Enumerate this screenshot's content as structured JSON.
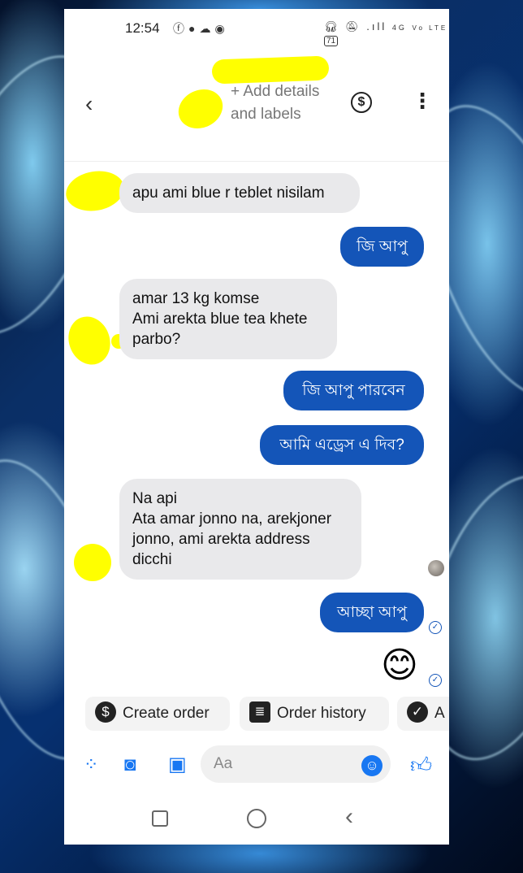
{
  "status_bar": {
    "time": "12:54",
    "left_icons": [
      "facebook-icon",
      "messenger-icon",
      "cloud-icon",
      "app-icon"
    ],
    "right_icons": [
      "headphones-icon",
      "mute-icon",
      "signal-icon",
      "4g-icon",
      "volte-icon"
    ],
    "signal_label": ".ıll",
    "network": "4G",
    "volte": "Vo LTE",
    "battery": "71"
  },
  "header": {
    "back_icon": "chevron-left-icon",
    "add_details_label": "+ Add details and labels",
    "payment_icon": "dollar-circle-icon",
    "more_icon": "more-vertical-icon"
  },
  "messages": [
    {
      "side": "in",
      "text": "apu ami blue r teblet nisilam"
    },
    {
      "side": "out",
      "text": "জি আপু"
    },
    {
      "side": "in",
      "text": "amar 13 kg komse\nAmi arekta blue tea khete parbo?"
    },
    {
      "side": "out",
      "text": "জি আপু পারবেন"
    },
    {
      "side": "out",
      "text": "আমি এড্রেস এ দিব?"
    },
    {
      "side": "in",
      "text": "Na api\nAta amar jonno na, arekjoner jonno, ami arekta address dicchi"
    },
    {
      "side": "out",
      "text": "আচ্ছা আপু"
    },
    {
      "side": "out",
      "text": "😊"
    }
  ],
  "quick_actions": [
    {
      "label": "Create order",
      "icon": "dollar-icon"
    },
    {
      "label": "Order history",
      "icon": "receipt-icon"
    },
    {
      "label": "A",
      "icon": "check-circle-icon"
    }
  ],
  "composer": {
    "placeholder": "Aa",
    "icons": [
      "apps-icon",
      "camera-icon",
      "image-icon",
      "emoji-icon",
      "thumbs-up-icon"
    ]
  },
  "nav": {
    "icons": [
      "recents-icon",
      "home-icon",
      "back-icon"
    ]
  },
  "colors": {
    "outgoing_bubble": "#1455b8",
    "incoming_bubble": "#e9e9eb",
    "accent": "#1877f2",
    "redaction": "#ffff00"
  }
}
